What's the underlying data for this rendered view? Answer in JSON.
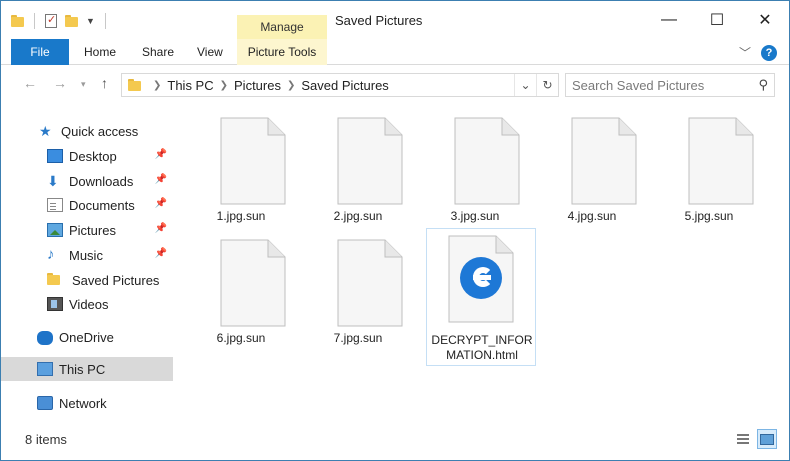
{
  "window": {
    "title": "Saved Pictures",
    "context_tab_group": "Manage",
    "controls": {
      "minimize": "—",
      "maximize": "☐",
      "close": "✕"
    }
  },
  "ribbon": {
    "tabs": [
      {
        "label": "File"
      },
      {
        "label": "Home"
      },
      {
        "label": "Share"
      },
      {
        "label": "View"
      },
      {
        "label": "Picture Tools"
      }
    ]
  },
  "address": {
    "crumbs": [
      "This PC",
      "Pictures",
      "Saved Pictures"
    ]
  },
  "search": {
    "placeholder": "Search Saved Pictures"
  },
  "sidebar": {
    "items": [
      {
        "label": "Quick access",
        "icon": "star-icon"
      },
      {
        "label": "Desktop",
        "icon": "desktop-icon",
        "pinned": true
      },
      {
        "label": "Downloads",
        "icon": "download-icon",
        "pinned": true
      },
      {
        "label": "Documents",
        "icon": "documents-icon",
        "pinned": true
      },
      {
        "label": "Pictures",
        "icon": "pictures-icon",
        "pinned": true
      },
      {
        "label": "Music",
        "icon": "music-icon",
        "pinned": true
      },
      {
        "label": "Saved Pictures",
        "icon": "folder-icon"
      },
      {
        "label": "Videos",
        "icon": "videos-icon"
      },
      {
        "label": "OneDrive",
        "icon": "onedrive-icon"
      },
      {
        "label": "This PC",
        "icon": "computer-icon",
        "selected": true
      },
      {
        "label": "Network",
        "icon": "network-icon"
      }
    ]
  },
  "files": [
    {
      "name": "1.jpg.sun",
      "icon": "blank-file-icon"
    },
    {
      "name": "2.jpg.sun",
      "icon": "blank-file-icon"
    },
    {
      "name": "3.jpg.sun",
      "icon": "blank-file-icon"
    },
    {
      "name": "4.jpg.sun",
      "icon": "blank-file-icon"
    },
    {
      "name": "5.jpg.sun",
      "icon": "blank-file-icon"
    },
    {
      "name": "6.jpg.sun",
      "icon": "blank-file-icon"
    },
    {
      "name": "7.jpg.sun",
      "icon": "blank-file-icon"
    },
    {
      "name": "DECRYPT_INFORMATION.html",
      "name_line1": "DECRYPT_INFOR",
      "name_line2": "MATION.html",
      "icon": "edge-html-icon",
      "selected": true
    }
  ],
  "status": {
    "item_count": "8 items"
  },
  "colors": {
    "accent": "#1979ca",
    "manage_tab": "#fbf2b4",
    "selection": "#cce8ff"
  }
}
